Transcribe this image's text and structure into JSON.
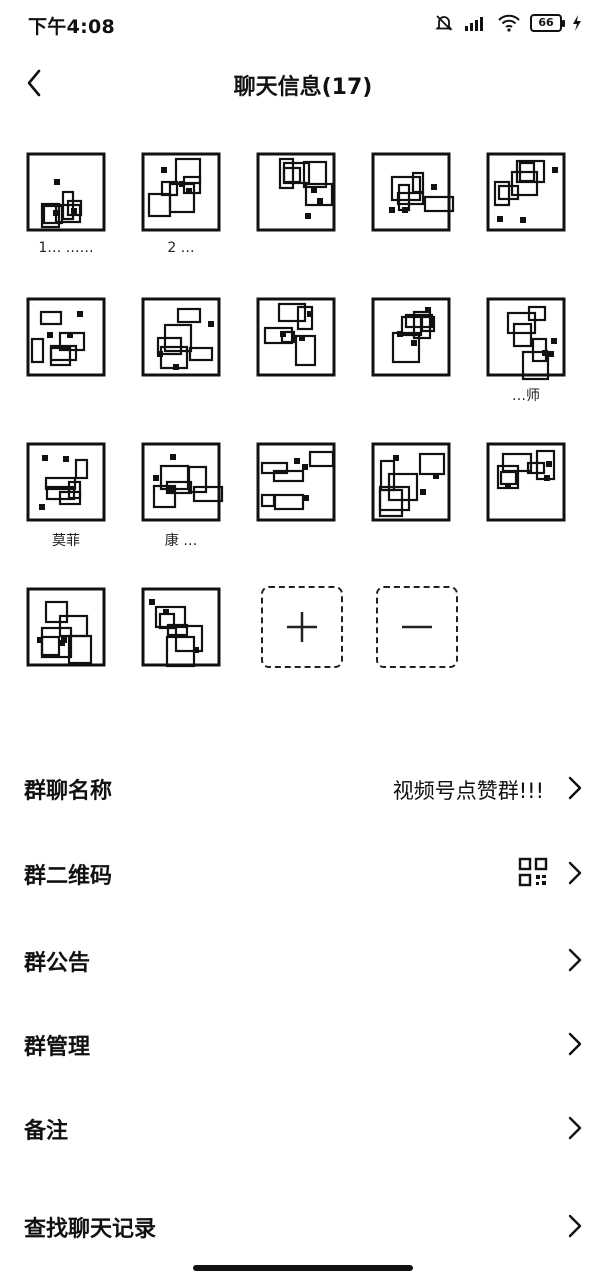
{
  "status_bar": {
    "time": "下午4:08",
    "battery": "66"
  },
  "header": {
    "title": "聊天信息(17)"
  },
  "members": [
    {
      "name": "1… ……"
    },
    {
      "name": "2 …"
    },
    {
      "name": ""
    },
    {
      "name": ""
    },
    {
      "name": ""
    },
    {
      "name": ""
    },
    {
      "name": ""
    },
    {
      "name": ""
    },
    {
      "name": ""
    },
    {
      "name": "…师"
    },
    {
      "name": "莫菲"
    },
    {
      "name": "康 …"
    },
    {
      "name": ""
    },
    {
      "name": ""
    },
    {
      "name": ""
    },
    {
      "name": ""
    },
    {
      "name": ""
    }
  ],
  "actions": {
    "add_symbol": "+",
    "remove_symbol": "—"
  },
  "settings": [
    {
      "label": "群聊名称",
      "value": "视频号点赞群!!!"
    },
    {
      "label": "群二维码",
      "value": ""
    },
    {
      "label": "群公告",
      "value": ""
    },
    {
      "label": "群管理",
      "value": ""
    },
    {
      "label": "备注",
      "value": ""
    },
    {
      "label": "查找聊天记录",
      "value": ""
    }
  ],
  "icons": {
    "back": "chevron-left-icon",
    "chevron": "chevron-right-icon",
    "qr": "qr-code-icon",
    "add": "plus-icon",
    "remove": "minus-icon"
  }
}
